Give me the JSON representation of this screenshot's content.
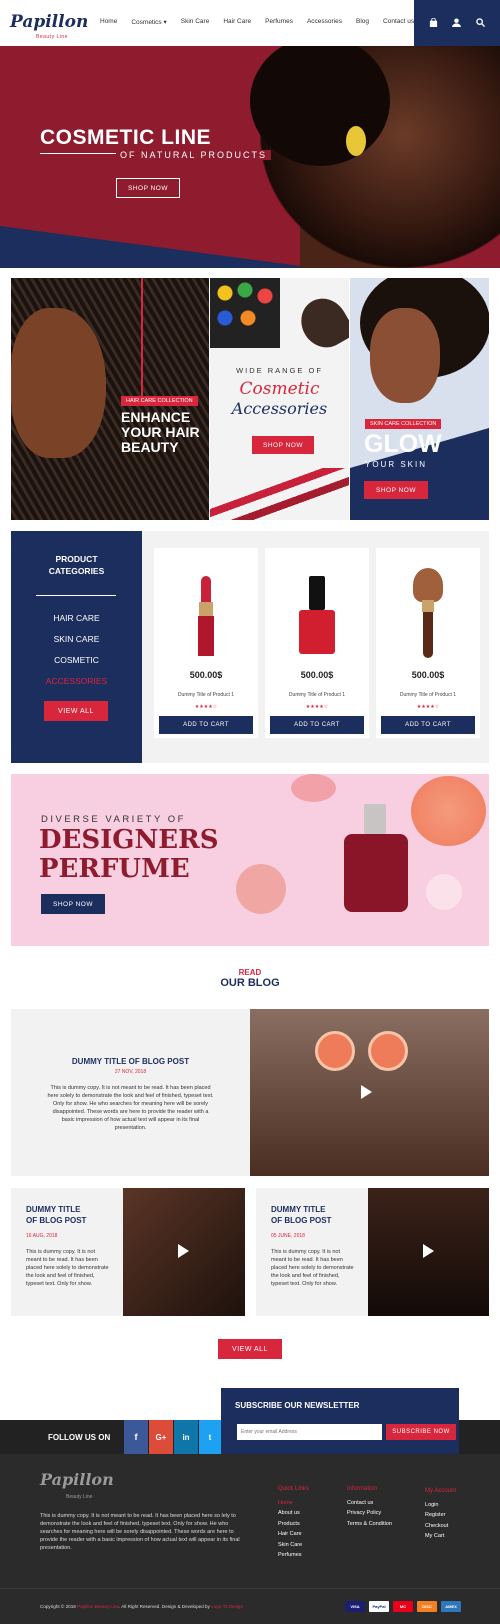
{
  "header": {
    "logo": "Papillon",
    "logo_sub": "Beauty Line",
    "nav": [
      "Home",
      "Cosmetics",
      "Skin Care",
      "Hair Care",
      "Perfumes",
      "Accessories",
      "Blog",
      "Contact us"
    ],
    "icons": [
      "bag-icon",
      "user-icon",
      "search-icon"
    ]
  },
  "hero": {
    "title": "COSMETIC LINE",
    "subtitle": "OF NATURAL PRODUCTS",
    "button": "SHOP NOW"
  },
  "promo": {
    "hair": {
      "tag": "HAIR CARE COLLECTION",
      "title": "ENHANCE YOUR HAIR BEAUTY"
    },
    "accessories": {
      "pre": "WIDE RANGE OF",
      "title1": "Cosmetic",
      "title2": "Accessories",
      "button": "SHOP NOW"
    },
    "skin": {
      "tag": "SKIN CARE COLLECTION",
      "title": "GLOW",
      "sub": "YOUR SKIN",
      "button": "SHOP NOW"
    }
  },
  "categories": {
    "title1": "PRODUCT",
    "title2": "CATEGORIES",
    "items": [
      "HAIR CARE",
      "SKIN CARE",
      "COSMETIC",
      "ACCESSORIES"
    ],
    "button": "VIEW ALL"
  },
  "products": [
    {
      "price": "500.00$",
      "title": "Dummy Title of Product 1",
      "stars": "★★★★☆",
      "button": "ADD TO CART"
    },
    {
      "price": "500.00$",
      "title": "Dummy Title of Product 1",
      "stars": "★★★★☆",
      "button": "ADD TO CART"
    },
    {
      "price": "500.00$",
      "title": "Dummy Title of Product 1",
      "stars": "★★★★☆",
      "button": "ADD TO CART"
    }
  ],
  "perfume": {
    "pre": "DIVERSE VARIETY OF",
    "title1": "DESIGNERS",
    "title2": "PERFUME",
    "button": "SHOP NOW"
  },
  "blog": {
    "kicker": "READ",
    "heading": "OUR BLOG",
    "main": {
      "title": "DUMMY TITLE OF BLOG POST",
      "date": "27 NOV, 2018",
      "text": "This is dummy copy. It is not meant to be read. It has been placed here solely to demonstrate the look and feel of finished, typeset text. Only for show. He who searches for meaning here will be sorely disappointed. These words are here to provide the reader with a basic impression of how actual text will appear in its final presentation."
    },
    "posts": [
      {
        "title1": "DUMMY TITLE",
        "title2": "OF BLOG POST",
        "date": "16 AUG, 2018",
        "text": "This is dummy copy. It is not meant to be read. It has been placed here solely to demonstrate the look and feel of finished, typeset text. Only for show."
      },
      {
        "title1": "DUMMY TITLE",
        "title2": "OF BLOG POST",
        "date": "05 JUNE, 2018",
        "text": "This is dummy copy. It is not meant to be read. It has been placed here solely to demonstrate the look and feel of finished, typeset text. Only for show."
      }
    ],
    "button": "VIEW ALL"
  },
  "newsletter": {
    "title": "SUBSCRIBE OUR NEWSLETTER",
    "placeholder": "Enter your email Address",
    "button": "SUBSCRIBE NOW"
  },
  "follow": {
    "label": "FOLLOW US ON",
    "icons": [
      "f",
      "G+",
      "in",
      "t"
    ]
  },
  "footer": {
    "about": "This is dummy copy. It is not meant to be read. It has been placed here so lely to demonstrate the look and feel of finished, typeset text. Only for show. He who searches for meaning here will be sorely disappointed. These words are here to provide the reader with a basic impression of how actual text will appear in its final presentation.",
    "quick_links": {
      "heading": "Quick Links",
      "items": [
        "Home",
        "About us",
        "Products",
        "Hair Care",
        "Skin Care",
        "Perfumes"
      ]
    },
    "information": {
      "heading": "Information",
      "items": [
        "Contact us",
        "Privacy Policy",
        "Terms & Condition"
      ]
    },
    "account": {
      "heading": "My Account",
      "items": [
        "Login",
        "Register",
        "Checkout",
        "My Cart"
      ]
    },
    "copyright_pre": "Copyright © 2018",
    "copyright_brand": "Papillon Beauty Line",
    "copyright_mid": ". All Right Reserved. Design & Developed by",
    "copyright_dev": "Logo To Design",
    "payments": [
      "VISA",
      "PayPal",
      "MC",
      "DISC",
      "AMEX"
    ]
  },
  "colors": {
    "navy": "#1c2e5e",
    "red": "#d8263d",
    "maroon": "#8e1b2e",
    "pink": "#f8cfe0"
  }
}
